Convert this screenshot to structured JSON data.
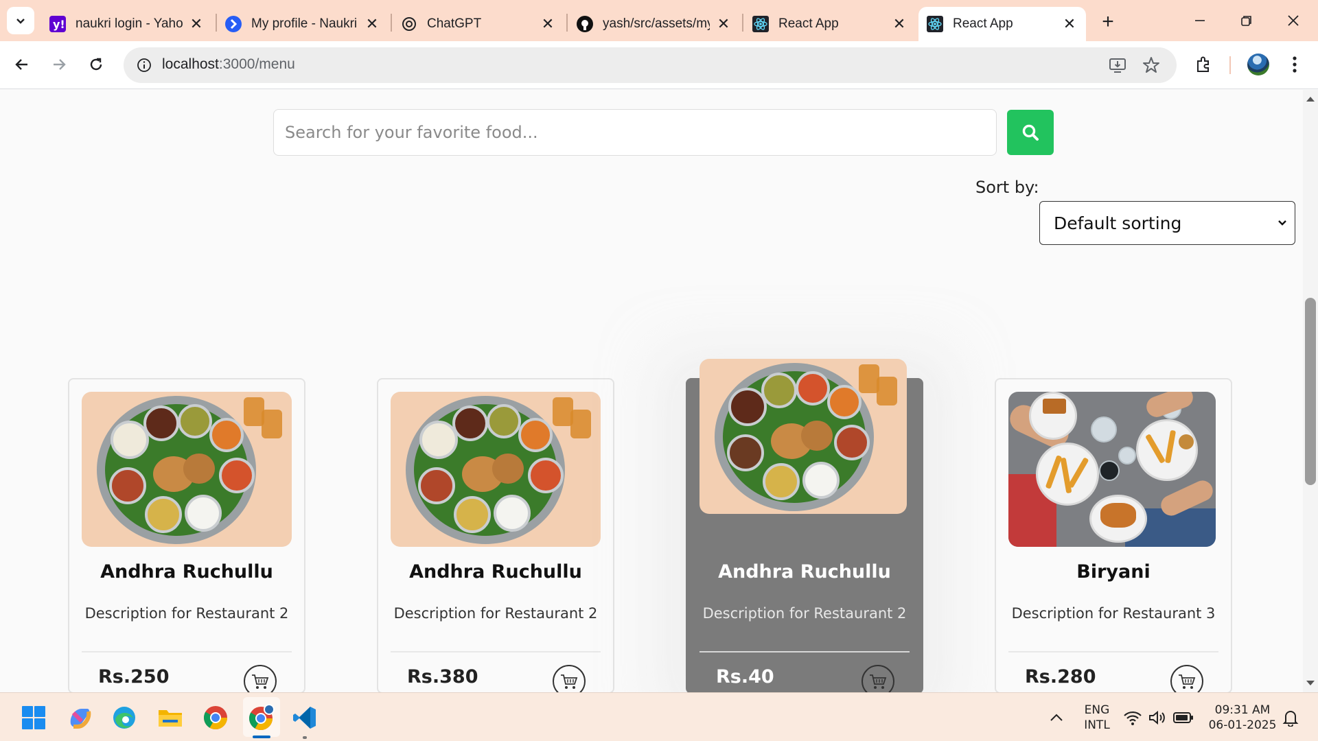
{
  "browser": {
    "tabs": [
      {
        "title": "naukri login - Yaho",
        "icon": "yahoo-icon"
      },
      {
        "title": "My profile - Naukri",
        "icon": "naukri-icon"
      },
      {
        "title": "ChatGPT",
        "icon": "chatgpt-icon"
      },
      {
        "title": "yash/src/assets/my",
        "icon": "github-icon"
      },
      {
        "title": "React App",
        "icon": "react-icon"
      },
      {
        "title": "React App",
        "icon": "react-icon",
        "active": true
      }
    ],
    "url_host": "localhost",
    "url_path": ":3000/menu"
  },
  "page": {
    "search_placeholder": "Search for your favorite food...",
    "sort_label": "Sort by:",
    "sort_selected": "Default sorting",
    "cards": [
      {
        "name": "Andhra Ruchullu",
        "description": "Description for Restaurant 2",
        "price": "Rs.250"
      },
      {
        "name": "Andhra Ruchullu",
        "description": "Description for Restaurant 2",
        "price": "Rs.380"
      },
      {
        "name": "Andhra Ruchullu",
        "description": "Description for Restaurant 2",
        "price": "Rs.40"
      },
      {
        "name": "Biryani",
        "description": "Description for Restaurant 3",
        "price": "Rs.280"
      }
    ]
  },
  "taskbar": {
    "lang_top": "ENG",
    "lang_bottom": "INTL",
    "time": "09:31 AM",
    "date": "06-01-2025"
  },
  "colors": {
    "tabstrip": "#fcdccc",
    "search_button": "#22c35e",
    "hover_card": "#7b7b7b"
  }
}
